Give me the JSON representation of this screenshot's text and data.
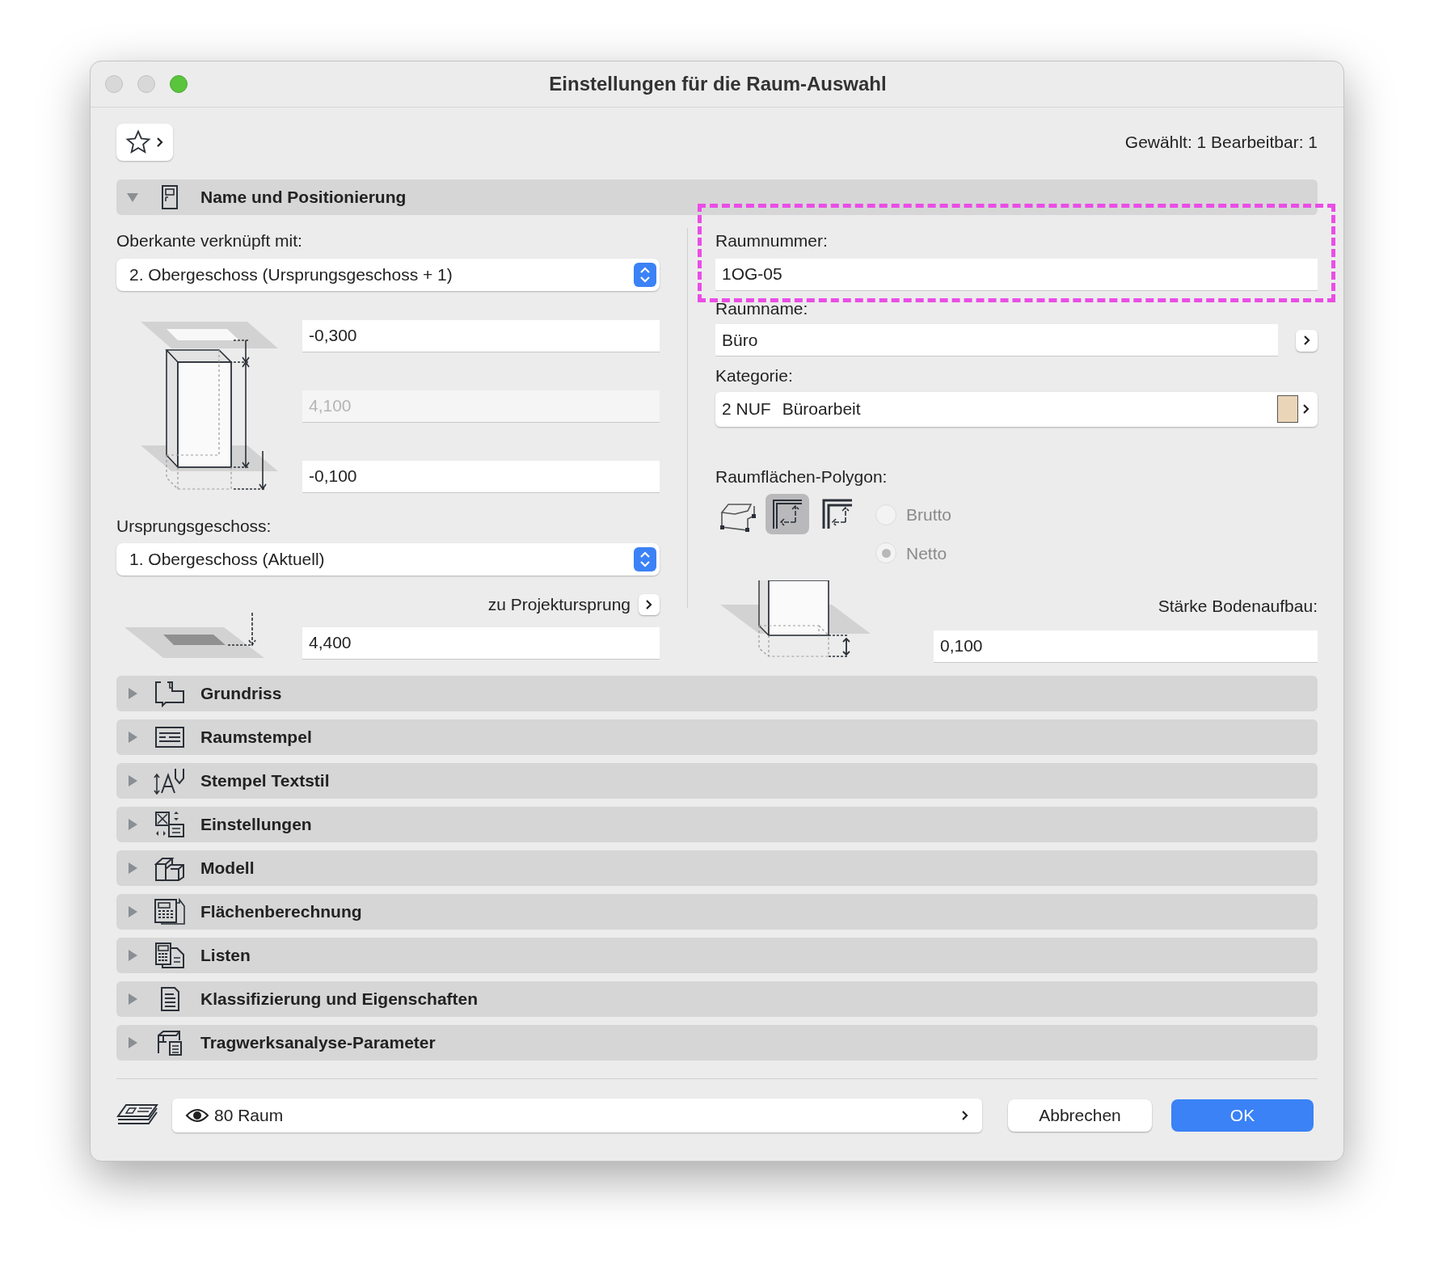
{
  "window": {
    "title": "Einstellungen für die Raum-Auswahl"
  },
  "selection_info": "Gewählt: 1 Bearbeitbar: 1",
  "sections": [
    {
      "title": "Name und Positionierung",
      "expanded": true
    },
    {
      "title": "Grundriss",
      "expanded": false
    },
    {
      "title": "Raumstempel",
      "expanded": false
    },
    {
      "title": "Stempel Textstil",
      "expanded": false
    },
    {
      "title": "Einstellungen",
      "expanded": false
    },
    {
      "title": "Modell",
      "expanded": false
    },
    {
      "title": "Flächenberechnung",
      "expanded": false
    },
    {
      "title": "Listen",
      "expanded": false
    },
    {
      "title": "Klassifizierung und Eigenschaften",
      "expanded": false
    },
    {
      "title": "Tragwerksanalyse-Parameter",
      "expanded": false
    }
  ],
  "name_position": {
    "top_link": {
      "label": "Oberkante verknüpft mit:",
      "value": "2. Obergeschoss (Ursprungsgeschoss + 1)"
    },
    "offsets": [
      {
        "value": "-0,300",
        "disabled": false
      },
      {
        "value": "4,100",
        "disabled": true
      },
      {
        "value": "-0,100",
        "disabled": false
      }
    ],
    "home_story": {
      "label": "Ursprungsgeschoss:",
      "value": "1. Obergeschoss (Aktuell)"
    },
    "project_origin_link": "zu Projektursprung",
    "elevation": "4,400",
    "room_number": {
      "label": "Raumnummer:",
      "value": "1OG-05",
      "highlighted": true
    },
    "room_name": {
      "label": "Raumname:",
      "value": "Büro"
    },
    "category": {
      "label": "Kategorie:",
      "code": "2 NUF",
      "name": "Büroarbeit",
      "color": "#ead5b8"
    },
    "polygon": {
      "label": "Raumflächen-Polygon:",
      "buttons": [
        {
          "selected": false
        },
        {
          "selected": true
        },
        {
          "selected": false
        }
      ],
      "options": [
        {
          "label": "Brutto",
          "selected": false,
          "disabled": true
        },
        {
          "label": "Netto",
          "selected": true,
          "disabled": true
        }
      ]
    },
    "floor_thickness": {
      "label": "Stärke Bodenaufbau:",
      "value": "0,100"
    }
  },
  "footer": {
    "layer": "80 Raum",
    "cancel": "Abbrechen",
    "ok": "OK"
  }
}
